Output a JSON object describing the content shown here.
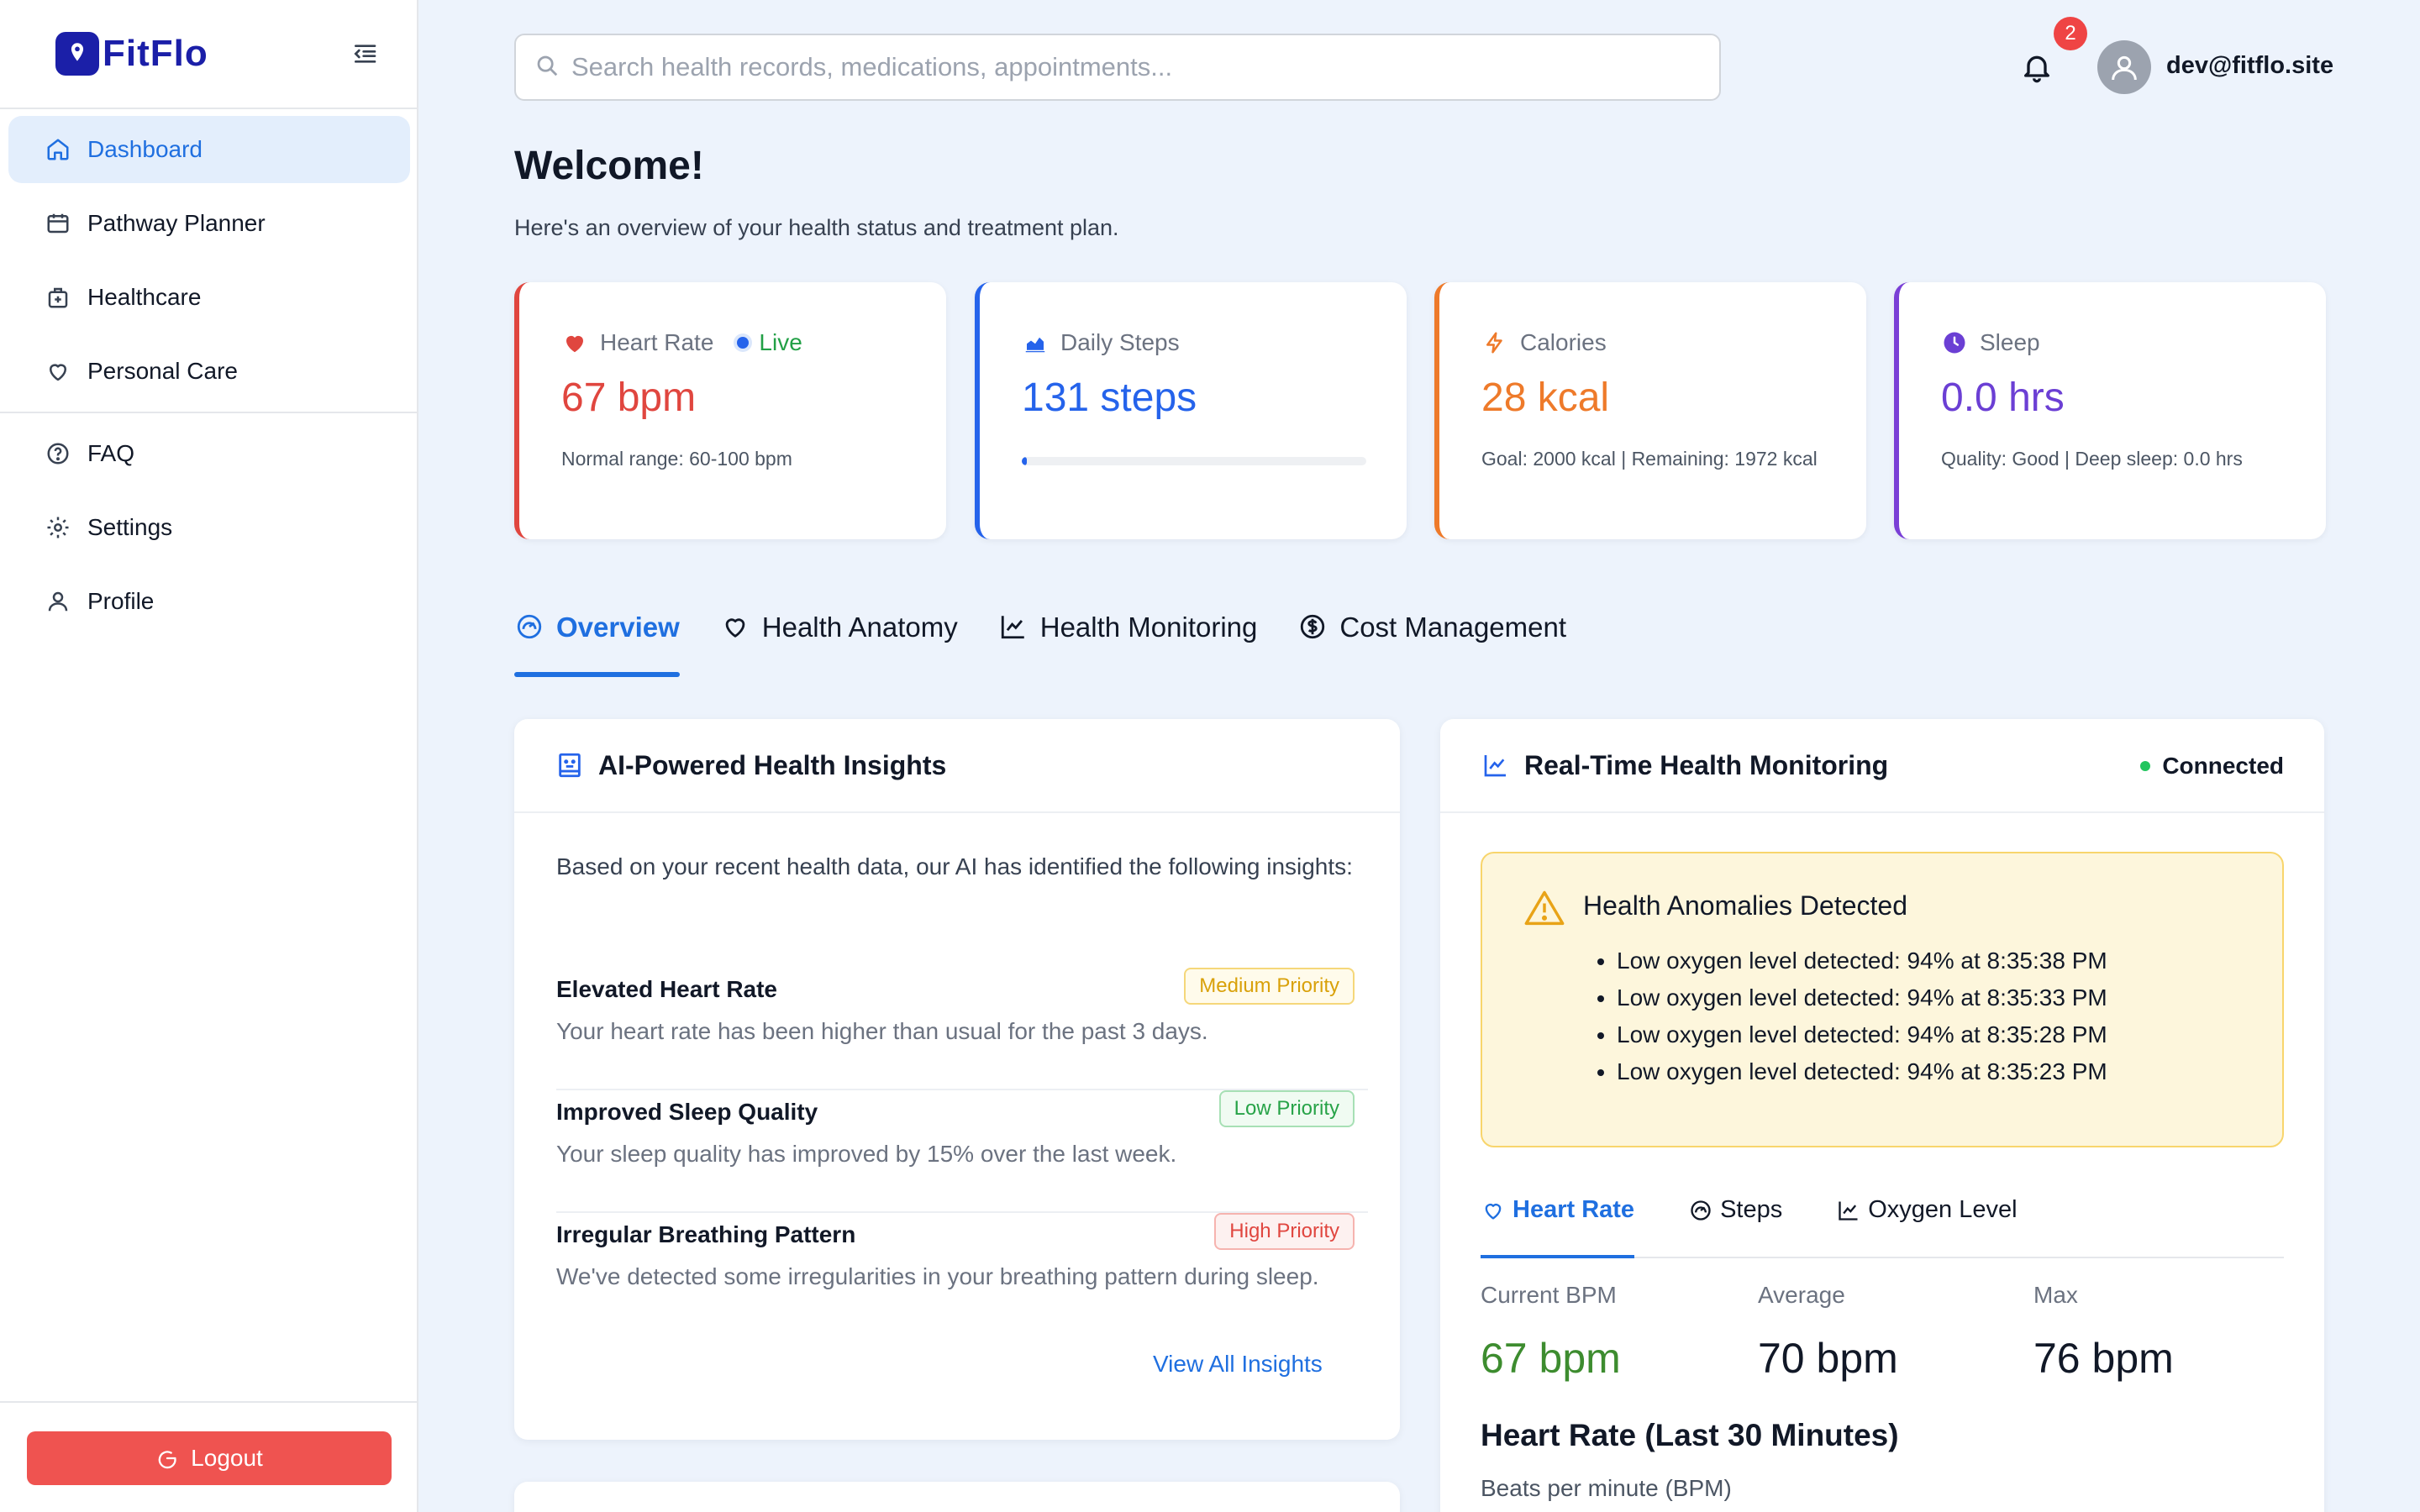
{
  "brand": {
    "name": "FitFlo"
  },
  "sidebar": {
    "items": [
      {
        "label": "Dashboard",
        "icon": "home-icon",
        "active": true
      },
      {
        "label": "Pathway Planner",
        "icon": "calendar-icon"
      },
      {
        "label": "Healthcare",
        "icon": "medical-bag-icon"
      },
      {
        "label": "Personal Care",
        "icon": "heart-icon"
      }
    ],
    "secondary": [
      {
        "label": "FAQ",
        "icon": "help-circle-icon"
      },
      {
        "label": "Settings",
        "icon": "gear-icon"
      },
      {
        "label": "Profile",
        "icon": "user-icon"
      }
    ],
    "logout_label": "Logout"
  },
  "topbar": {
    "search_placeholder": "Search health records, medications, appointments...",
    "notification_count": "2",
    "user_email": "dev@fitflo.site"
  },
  "header": {
    "title": "Welcome!",
    "subtitle": "Here's an overview of your health status and treatment plan."
  },
  "stats": {
    "heart": {
      "label": "Heart Rate",
      "live": "Live",
      "value": "67 bpm",
      "note": "Normal range: 60-100 bpm",
      "color": "#e0463f"
    },
    "steps": {
      "label": "Daily Steps",
      "value": "131 steps",
      "progress": 0.0131,
      "color": "#2563eb"
    },
    "calories": {
      "label": "Calories",
      "value": "28 kcal",
      "note": "Goal: 2000 kcal | Remaining: 1972 kcal",
      "color": "#ee7a2a"
    },
    "sleep": {
      "label": "Sleep",
      "value": "0.0 hrs",
      "note": "Quality: Good | Deep sleep: 0.0 hrs",
      "color": "#7a3fd6"
    }
  },
  "tabs": [
    {
      "label": "Overview",
      "icon": "gauge-icon",
      "active": true
    },
    {
      "label": "Health Anatomy",
      "icon": "heart-icon"
    },
    {
      "label": "Health Monitoring",
      "icon": "line-chart-icon"
    },
    {
      "label": "Cost Management",
      "icon": "dollar-circle-icon"
    }
  ],
  "insights": {
    "title": "AI-Powered Health Insights",
    "intro": "Based on your recent health data, our AI has identified the following insights:",
    "items": [
      {
        "title": "Elevated Heart Rate",
        "desc": "Your heart rate has been higher than usual for the past 3 days.",
        "priority": "Medium Priority",
        "level": "medium"
      },
      {
        "title": "Improved Sleep Quality",
        "desc": "Your sleep quality has improved by 15% over the last week.",
        "priority": "Low Priority",
        "level": "low"
      },
      {
        "title": "Irregular Breathing Pattern",
        "desc": "We've detected some irregularities in your breathing pattern during sleep.",
        "priority": "High Priority",
        "level": "high"
      }
    ],
    "view_all": "View All Insights"
  },
  "monitoring": {
    "title": "Real-Time Health Monitoring",
    "status": "Connected",
    "alert_title": "Health Anomalies Detected",
    "alerts": [
      "Low oxygen level detected: 94% at 8:35:38 PM",
      "Low oxygen level detected: 94% at 8:35:33 PM",
      "Low oxygen level detected: 94% at 8:35:28 PM",
      "Low oxygen level detected: 94% at 8:35:23 PM"
    ],
    "subtabs": [
      {
        "label": "Heart Rate",
        "icon": "heart-icon",
        "active": true
      },
      {
        "label": "Steps",
        "icon": "gauge-icon"
      },
      {
        "label": "Oxygen Level",
        "icon": "line-chart-icon"
      }
    ],
    "metrics": {
      "current": {
        "label": "Current BPM",
        "value": "67 bpm"
      },
      "average": {
        "label": "Average",
        "value": "70 bpm"
      },
      "max": {
        "label": "Max",
        "value": "76 bpm"
      }
    },
    "chart_title": "Heart Rate (Last 30 Minutes)",
    "chart_subtitle": "Beats per minute (BPM)"
  }
}
